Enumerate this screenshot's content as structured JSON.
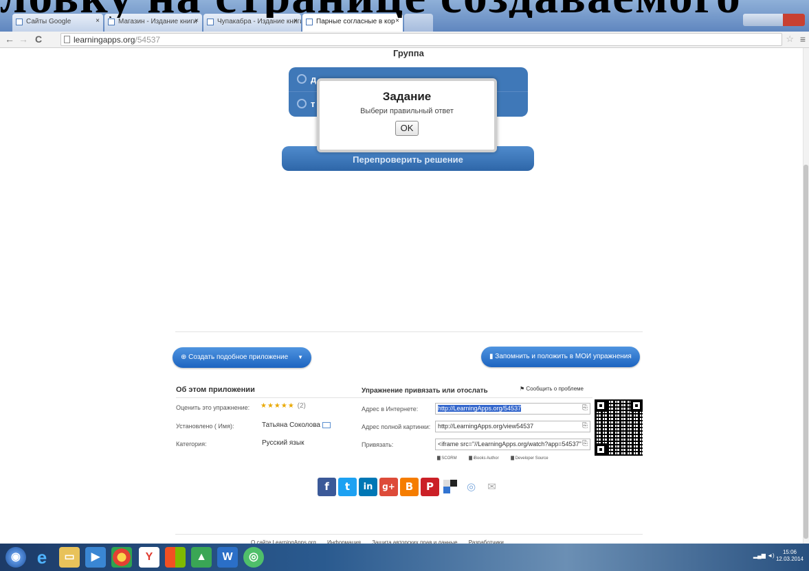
{
  "slide_heading": "ловку на странице создаваемого",
  "browser": {
    "tabs": [
      {
        "label": "Сайты Google"
      },
      {
        "label": "Магазин - Издание книги"
      },
      {
        "label": "Чупакабра - Издание книги"
      },
      {
        "label": "Парные согласные в кор"
      }
    ],
    "url_host": "learningapps.org",
    "url_path": "/54537"
  },
  "app": {
    "group_title": "Группа",
    "answers": [
      {
        "letter": "д"
      },
      {
        "letter": "т"
      }
    ],
    "check_button": "Перепроверить решение"
  },
  "modal": {
    "title": "Задание",
    "text": "Выбери правильный ответ",
    "ok": "OK"
  },
  "panel": {
    "create_similar": "Создать подобное приложение",
    "save_button": "Запомнить и положить в МОИ упражнения",
    "about_title": "Об этом приложении",
    "rate_label": "Оценить это упражнение:",
    "rating": 5,
    "rating_count": "(2)",
    "author_label": "Установлено ( Имя):",
    "author_value": "Татьяна Соколова",
    "category_label": "Категория:",
    "category_value": "Русский язык",
    "embed_title": "Упражнение привязать или отослать",
    "report_problem": "Сообщить о проблеме",
    "address_label": "Адрес в Интернете:",
    "address_value": "http://LearningApps.org/54537",
    "fullscreen_label": "Адрес полной картинки:",
    "fullscreen_value": "http://LearningApps.org/view54537",
    "embed_label": "Привязать:",
    "embed_value": "<iframe src=\"//LearningApps.org/watch?app=54537\"",
    "export_links": [
      "SCORM",
      "iBooks Author",
      "Developer Source"
    ]
  },
  "footer": {
    "links": [
      "О сайте LearningApps.org",
      "Информация",
      "Защита авторских прав и данные",
      "Разработчики"
    ]
  },
  "taskbar": {
    "clock": "15:06",
    "date": "12.03.2014"
  },
  "colors": {
    "app_blue": "#3f78b8",
    "pill_blue": "#1d64c0",
    "facebook": "#3b5998",
    "twitter": "#1da1f2",
    "linkedin": "#0077b5",
    "googleplus": "#dd4b39",
    "blogger": "#f57d00",
    "pinterest": "#cb2027"
  }
}
